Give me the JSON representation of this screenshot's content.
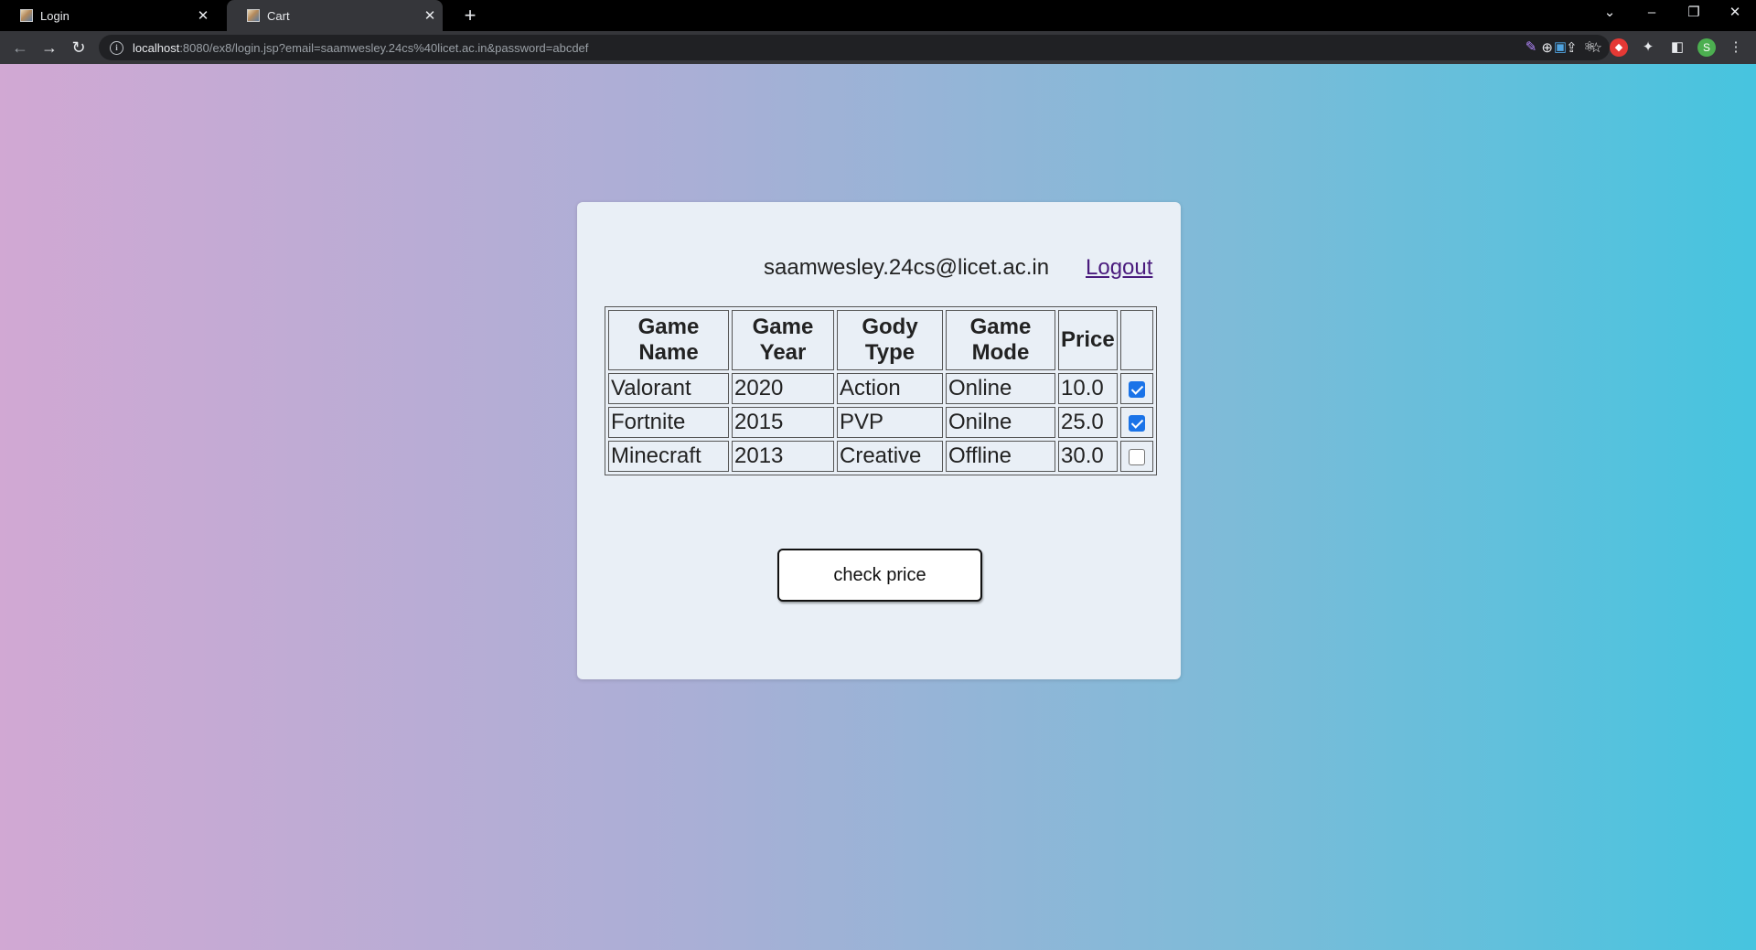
{
  "browser": {
    "tabs": [
      {
        "title": "Login",
        "close": "✕"
      },
      {
        "title": "Cart",
        "close": "✕"
      }
    ],
    "new_tab": "+",
    "window_controls": {
      "dropdown": "⌄",
      "minimize": "–",
      "restore": "❐",
      "close": "✕"
    },
    "nav": {
      "back": "←",
      "forward": "→",
      "reload": "↻"
    },
    "url_host": "localhost",
    "url_rest": ":8080/ex8/login.jsp?email=saamwesley.24cs%40licet.ac.in&password=abcdef",
    "profile_initial": "S"
  },
  "header": {
    "user_email": "saamwesley.24cs@licet.ac.in",
    "logout_label": "Logout"
  },
  "table": {
    "headers": [
      [
        "Game",
        "Name"
      ],
      [
        "Game",
        "Year"
      ],
      [
        "Gody",
        "Type"
      ],
      [
        "Game",
        "Mode"
      ],
      [
        "Price"
      ]
    ],
    "rows": [
      {
        "name": "Valorant",
        "year": "2020",
        "type": "Action",
        "mode": "Online",
        "price": "10.0",
        "checked": true
      },
      {
        "name": "Fortnite",
        "year": "2015",
        "type": "PVP",
        "mode": "Onilne",
        "price": "25.0",
        "checked": true
      },
      {
        "name": "Minecraft",
        "year": "2013",
        "type": "Creative",
        "mode": "Offline",
        "price": "30.0",
        "checked": false
      }
    ]
  },
  "actions": {
    "check_price_label": "check price"
  },
  "colors": {
    "gradient_start": "#d1a8d3",
    "gradient_end": "#46c4df",
    "card_bg": "#e9eff6",
    "link": "#4a1b7d",
    "checkbox_on": "#1a73e8"
  }
}
